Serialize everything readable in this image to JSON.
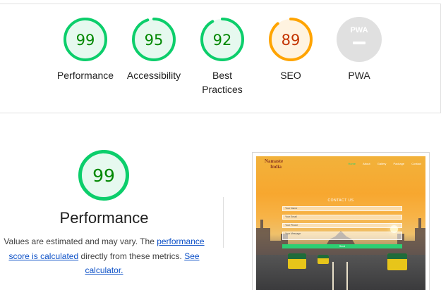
{
  "summary": {
    "gauges": [
      {
        "key": "performance",
        "score": "99",
        "label": "Performance",
        "color": "#0cce6b",
        "text_color": "#008800",
        "fraction": 0.99
      },
      {
        "key": "accessibility",
        "score": "95",
        "label": "Accessibility",
        "color": "#0cce6b",
        "text_color": "#008800",
        "fraction": 0.95
      },
      {
        "key": "best-practices",
        "score": "92",
        "label": "Best Practices",
        "color": "#0cce6b",
        "text_color": "#008800",
        "fraction": 0.92
      },
      {
        "key": "seo",
        "score": "89",
        "label": "SEO",
        "color": "#ffa400",
        "text_color": "#c33300",
        "fraction": 0.89
      },
      {
        "key": "pwa",
        "score": "PWA",
        "label": "PWA",
        "color": "#e0e0e0",
        "text_color": "#ffffff",
        "fraction": 0
      }
    ]
  },
  "performance": {
    "score": "99",
    "fraction": 0.99,
    "color": "#0cce6b",
    "title": "Performance",
    "desc_prefix": "Values are estimated and may vary. The ",
    "desc_link1": "performance score is calculated",
    "desc_middle": " directly from these metrics. ",
    "desc_link2": "See calculator."
  },
  "screenshot": {
    "brand_line1": "Namaste",
    "brand_line2": "India",
    "nav": [
      "Home",
      "About",
      "Gallery",
      "Package",
      "Contact"
    ],
    "heading": "CONTACT US",
    "fields": [
      "Your Name",
      "Your Email",
      "Your Phone",
      "Your Message"
    ],
    "send": "Send"
  }
}
